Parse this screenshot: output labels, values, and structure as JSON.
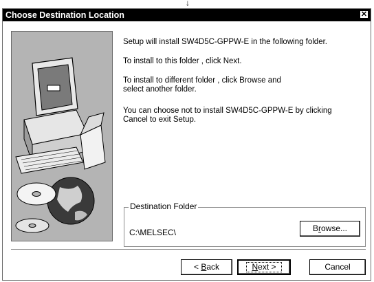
{
  "dialog": {
    "title": "Choose Destination Location",
    "close_glyph": "✕",
    "top_glyph": "↓"
  },
  "message": {
    "line1": "Setup will install SW4D5C-GPPW-E in the following folder.",
    "line2": "To install to this folder , click Next.",
    "line3a": "To install to different folder , click Browse and",
    "line3b": "select another folder.",
    "line4a": "You can choose not to install SW4D5C-GPPW-E by clicking",
    "line4b": "Cancel to exit Setup."
  },
  "destination": {
    "group_label": "Destination Folder",
    "path": "C:\\MELSEC\\",
    "browse_prefix": "B",
    "browse_mnemonic": "r",
    "browse_suffix": "owse..."
  },
  "buttons": {
    "back_prefix": "< ",
    "back_mnemonic": "B",
    "back_suffix": "ack",
    "next_mnemonic": "N",
    "next_suffix": "ext >",
    "cancel_label": "Cancel"
  },
  "icons": {
    "art": "computer-with-cds-illustration",
    "close": "close-icon",
    "arrow": "down-arrow-icon"
  }
}
